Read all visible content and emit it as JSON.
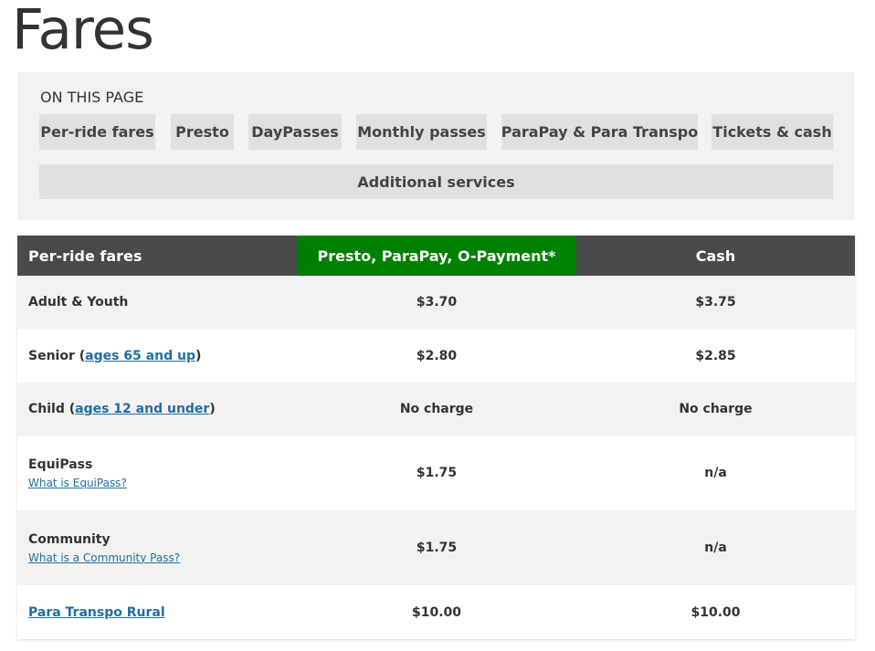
{
  "page": {
    "title": "Fares"
  },
  "toc": {
    "heading": "ON THIS PAGE",
    "items": [
      "Per-ride fares",
      "Presto",
      "DayPasses",
      "Monthly passes",
      "ParaPay & Para Transpo",
      "Tickets & cash",
      "Additional services"
    ]
  },
  "table": {
    "headers": [
      "Per-ride fares",
      "Presto, ParaPay, O-Payment*",
      "Cash"
    ],
    "rows": [
      {
        "label": "Adult & Youth",
        "presto": "$3.70",
        "cash": "$3.75"
      },
      {
        "label_prefix": "Senior (",
        "label_link": "ages 65 and up",
        "label_suffix": ")",
        "presto": "$2.80",
        "cash": "$2.85"
      },
      {
        "label_prefix": "Child (",
        "label_link": "ages 12 and under",
        "label_suffix": ")",
        "presto": "No charge",
        "cash": "No charge"
      },
      {
        "label": "EquiPass",
        "sublink": "What is EquiPass?",
        "presto": "$1.75",
        "cash": "n/a"
      },
      {
        "label": "Community",
        "sublink": "What is a Community Pass?",
        "presto": "$1.75",
        "cash": "n/a"
      },
      {
        "label_link": "Para Transpo Rural",
        "presto": "$10.00",
        "cash": "$10.00"
      }
    ]
  },
  "colors": {
    "header_bg": "#4a4a4a",
    "highlight_header_bg": "#008000",
    "link": "#1f6fa3",
    "toc_bg": "#f2f2f2",
    "toc_button_bg": "#e0e0e0"
  }
}
